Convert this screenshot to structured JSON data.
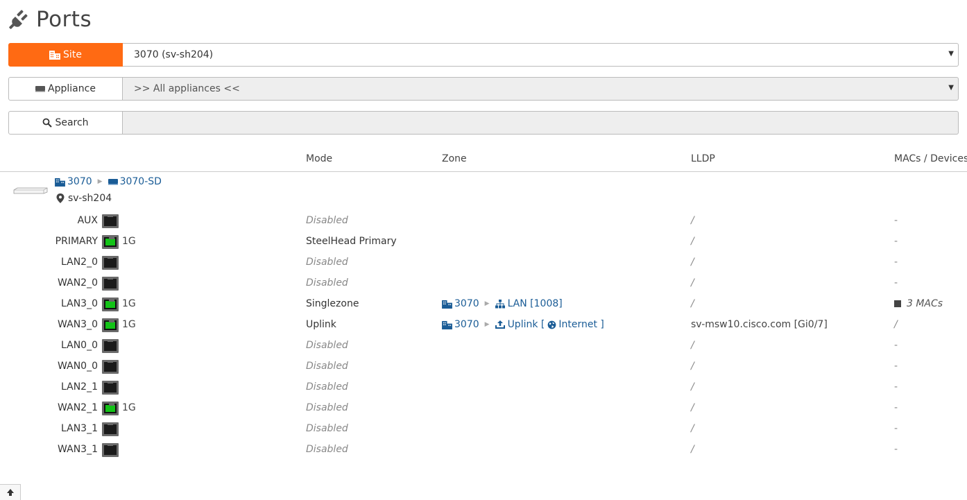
{
  "page": {
    "title": "Ports"
  },
  "filters": {
    "site": {
      "label": "Site",
      "value": "3070 (sv-sh204)"
    },
    "appliance": {
      "label": "Appliance",
      "value": ">> All appliances <<"
    },
    "search": {
      "label": "Search",
      "value": ""
    }
  },
  "table": {
    "columns": {
      "mode": "Mode",
      "zone": "Zone",
      "lldp": "LLDP",
      "macs": "MACs / Devices"
    }
  },
  "device": {
    "site": "3070",
    "appliance": "3070-SD",
    "location": "sv-sh204"
  },
  "ports": [
    {
      "name": "AUX",
      "link_up": false,
      "speed": "",
      "mode": "Disabled",
      "zone_site": "",
      "zone_name": "",
      "lldp": "/",
      "macs": "-"
    },
    {
      "name": "PRIMARY",
      "link_up": true,
      "speed": "1G",
      "mode": "SteelHead Primary",
      "zone_site": "",
      "zone_name": "",
      "lldp": "/",
      "macs": "-"
    },
    {
      "name": "LAN2_0",
      "link_up": false,
      "speed": "",
      "mode": "Disabled",
      "zone_site": "",
      "zone_name": "",
      "lldp": "/",
      "macs": "-"
    },
    {
      "name": "WAN2_0",
      "link_up": false,
      "speed": "",
      "mode": "Disabled",
      "zone_site": "",
      "zone_name": "",
      "lldp": "/",
      "macs": "-"
    },
    {
      "name": "LAN3_0",
      "link_up": true,
      "speed": "1G",
      "mode": "Singlezone",
      "zone_site": "3070",
      "zone_name": "LAN [1008]",
      "lldp": "/",
      "macs": "3 MACs"
    },
    {
      "name": "WAN3_0",
      "link_up": true,
      "speed": "1G",
      "mode": "Uplink",
      "zone_site": "3070",
      "zone_name": "Uplink [",
      "zone_internet": "Internet ]",
      "lldp": "sv-msw10.cisco.com [Gi0/7]",
      "macs": "/"
    },
    {
      "name": "LAN0_0",
      "link_up": false,
      "speed": "",
      "mode": "Disabled",
      "zone_site": "",
      "zone_name": "",
      "lldp": "/",
      "macs": "-"
    },
    {
      "name": "WAN0_0",
      "link_up": false,
      "speed": "",
      "mode": "Disabled",
      "zone_site": "",
      "zone_name": "",
      "lldp": "/",
      "macs": "-"
    },
    {
      "name": "LAN2_1",
      "link_up": false,
      "speed": "",
      "mode": "Disabled",
      "zone_site": "",
      "zone_name": "",
      "lldp": "/",
      "macs": "-"
    },
    {
      "name": "WAN2_1",
      "link_up": true,
      "speed": "1G",
      "mode": "Disabled",
      "zone_site": "",
      "zone_name": "",
      "lldp": "/",
      "macs": "-"
    },
    {
      "name": "LAN3_1",
      "link_up": false,
      "speed": "",
      "mode": "Disabled",
      "zone_site": "",
      "zone_name": "",
      "lldp": "/",
      "macs": "-"
    },
    {
      "name": "WAN3_1",
      "link_up": false,
      "speed": "",
      "mode": "Disabled",
      "zone_site": "",
      "zone_name": "",
      "lldp": "/",
      "macs": "-"
    }
  ],
  "colors": {
    "accent": "#ff6a13",
    "link": "#1a5c96",
    "port_up": "#13c317"
  }
}
